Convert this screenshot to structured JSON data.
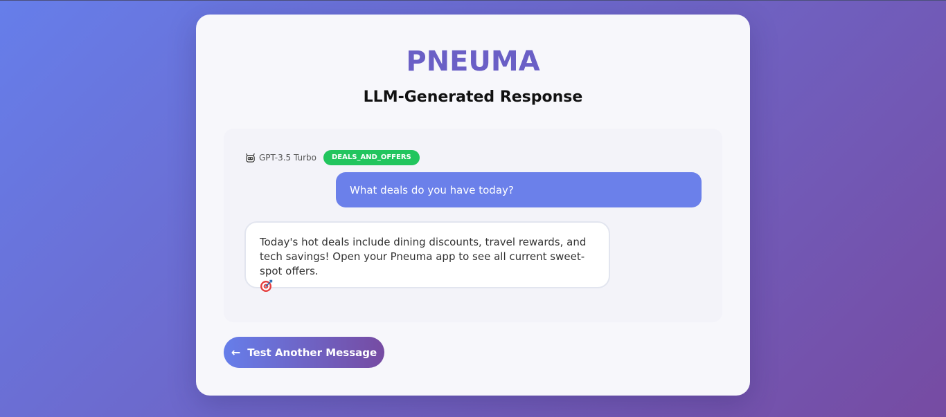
{
  "app": {
    "brand": "PNEUMA",
    "subtitle": "LLM-Generated Response"
  },
  "colors": {
    "brand": "#6a5fc6",
    "background_gradient_start": "#667eea",
    "background_gradient_end": "#764ba2",
    "user_bubble": "#6b80ea",
    "intent_badge": "#22c55e"
  },
  "response": {
    "model_icon": "robot-icon",
    "model_name": "GPT-3.5 Turbo",
    "intent": "DEALS_AND_OFFERS",
    "user_message": "What deals do you have today?",
    "bot_message": "Today's hot deals include dining discounts, travel rewards, and tech savings! Open your Pneuma app to see all current sweet-spot offers.",
    "bot_message_icon": "target-icon"
  },
  "actions": {
    "back_arrow": "←",
    "back_label": "Test Another Message"
  }
}
